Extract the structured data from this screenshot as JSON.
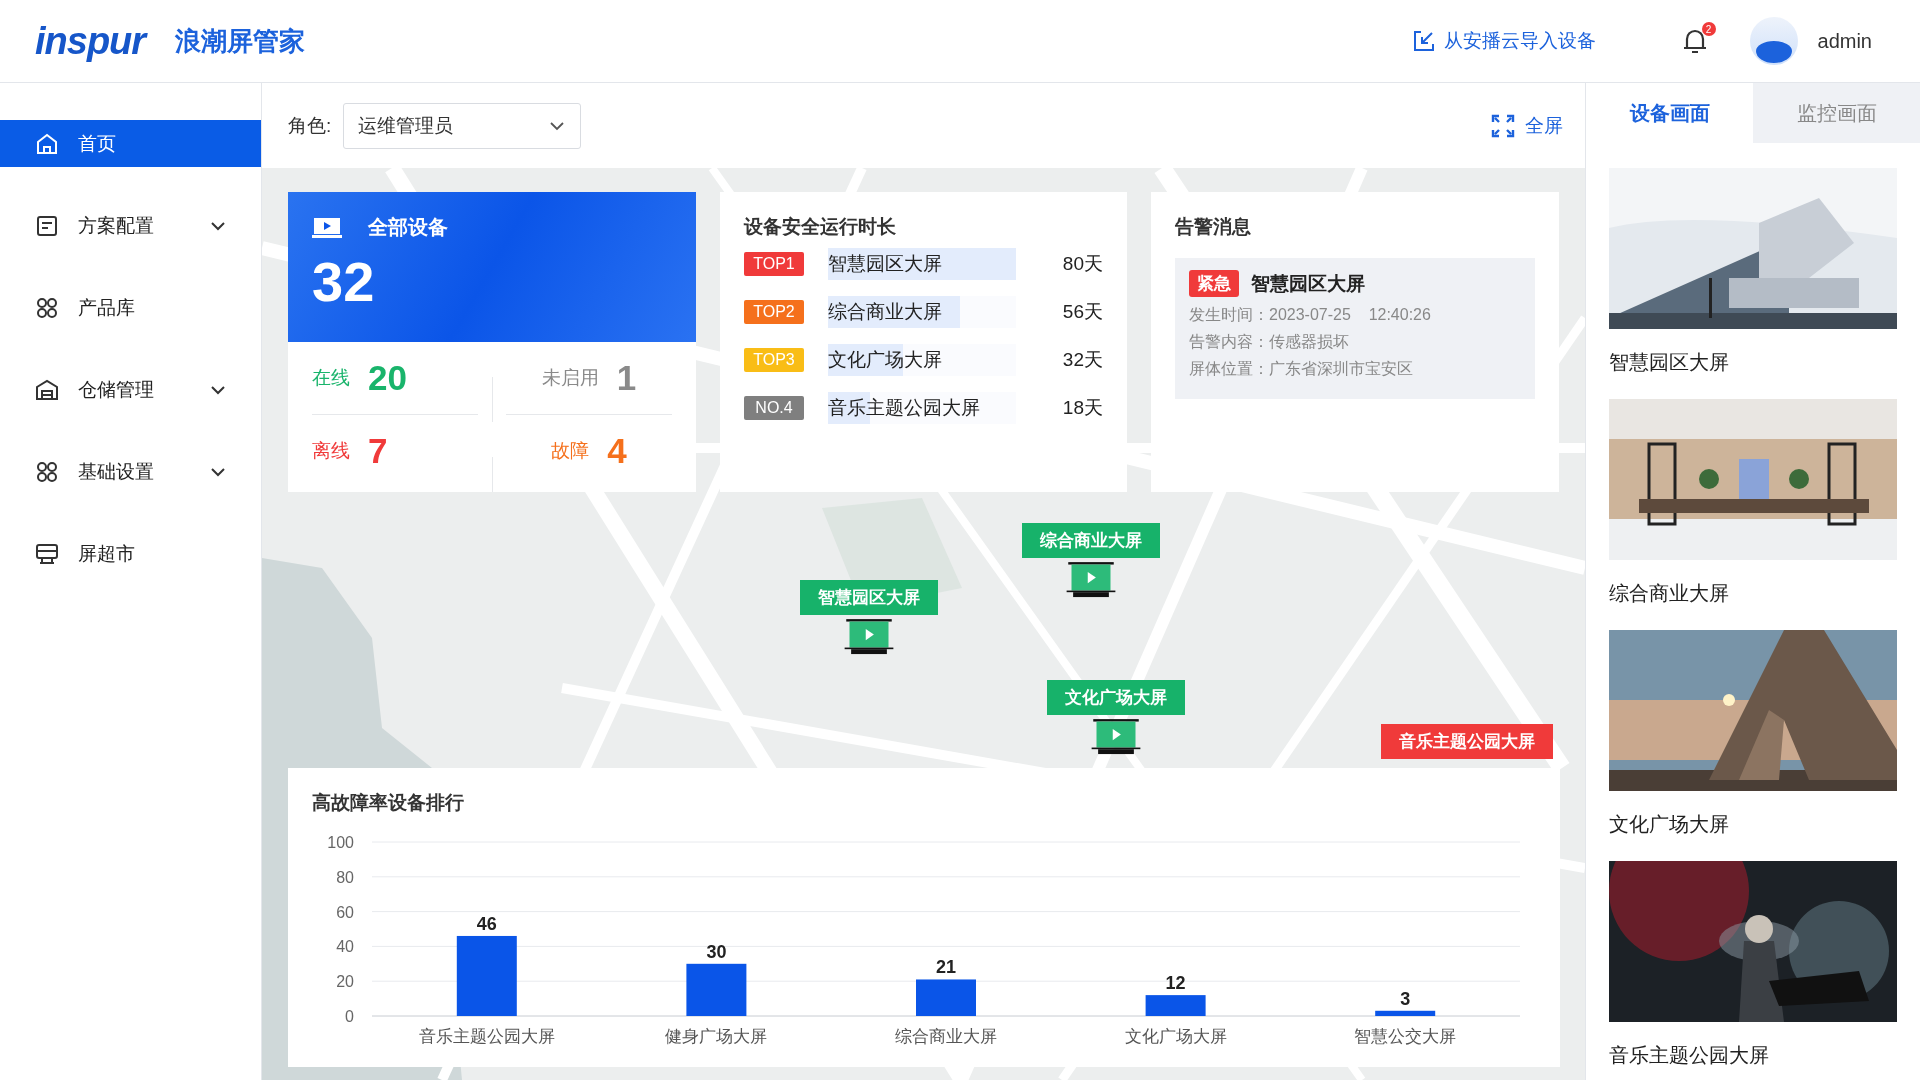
{
  "header": {
    "logo": "inspur",
    "title": "浪潮屏管家",
    "import_link": "从安播云导入设备",
    "notification_count": "2",
    "user": "admin"
  },
  "sidebar": {
    "items": [
      {
        "label": "首页",
        "selected": true,
        "expandable": false
      },
      {
        "label": "方案配置",
        "selected": false,
        "expandable": true
      },
      {
        "label": "产品库",
        "selected": false,
        "expandable": false
      },
      {
        "label": "仓储管理",
        "selected": false,
        "expandable": true
      },
      {
        "label": "基础设置",
        "selected": false,
        "expandable": true
      },
      {
        "label": "屏超市",
        "selected": false,
        "expandable": false
      }
    ]
  },
  "toolbar": {
    "role_label": "角色:",
    "role_value": "运维管理员",
    "fullscreen": "全屏"
  },
  "device_summary": {
    "title": "全部设备",
    "total": "32",
    "stats": [
      {
        "label": "在线",
        "value": "20",
        "color": "#19b46b"
      },
      {
        "label": "未启用",
        "value": "1",
        "color": "#8a8a8a"
      },
      {
        "label": "离线",
        "value": "7",
        "color": "#f03a3a"
      },
      {
        "label": "故障",
        "value": "4",
        "color": "#f5701c"
      }
    ]
  },
  "safety_ranking": {
    "title": "设备安全运行时长",
    "rows": [
      {
        "rank": "TOP1",
        "name": "智慧园区大屏",
        "days": "80天",
        "color": "#f03a3a",
        "level": 1
      },
      {
        "rank": "TOP2",
        "name": "综合商业大屏",
        "days": "56天",
        "color": "#f5701c",
        "level": 0.7
      },
      {
        "rank": "TOP3",
        "name": "文化广场大屏",
        "days": "32天",
        "color": "#f9bd16",
        "level": 0.4
      },
      {
        "rank": "NO.4",
        "name": "音乐主题公园大屏",
        "days": "18天",
        "color": "#7f7f7f",
        "level": 0.225
      }
    ]
  },
  "alert": {
    "title": "告警消息",
    "severity": "紧急",
    "device": "智慧园区大屏",
    "lines": [
      "发生时间：2023-07-25    12:40:26",
      "告警内容：传感器损坏",
      "屏体位置：广东省深圳市宝安区"
    ]
  },
  "map": {
    "markers": [
      {
        "label": "智慧园区大屏",
        "color": "#17b26a",
        "kind": "screen"
      },
      {
        "label": "综合商业大屏",
        "color": "#17b26a",
        "kind": "screen"
      },
      {
        "label": "文化广场大屏",
        "color": "#17b26a",
        "kind": "screen"
      },
      {
        "label": "音乐主题公园大屏",
        "color": "#f03a3a",
        "kind": "label"
      }
    ]
  },
  "fault_ranking": {
    "chart_data": {
      "type": "bar",
      "title": "高故障率设备排行",
      "categories": [
        "音乐主题公园大屏",
        "健身广场大屏",
        "综合商业大屏",
        "文化广场大屏",
        "智慧公交大屏"
      ],
      "values": [
        46,
        30,
        21,
        12,
        3
      ],
      "ylim": [
        0,
        100
      ],
      "yticks": [
        0,
        20,
        40,
        60,
        80,
        100
      ],
      "data_labels": true,
      "grid": true
    }
  },
  "screen_panel": {
    "tabs": [
      {
        "label": "设备画面",
        "selected": true
      },
      {
        "label": "监控画面",
        "selected": false
      }
    ],
    "screens": [
      {
        "name": "智慧园区大屏"
      },
      {
        "name": "综合商业大屏"
      },
      {
        "name": "文化广场大屏"
      },
      {
        "name": "音乐主题公园大屏"
      }
    ]
  }
}
